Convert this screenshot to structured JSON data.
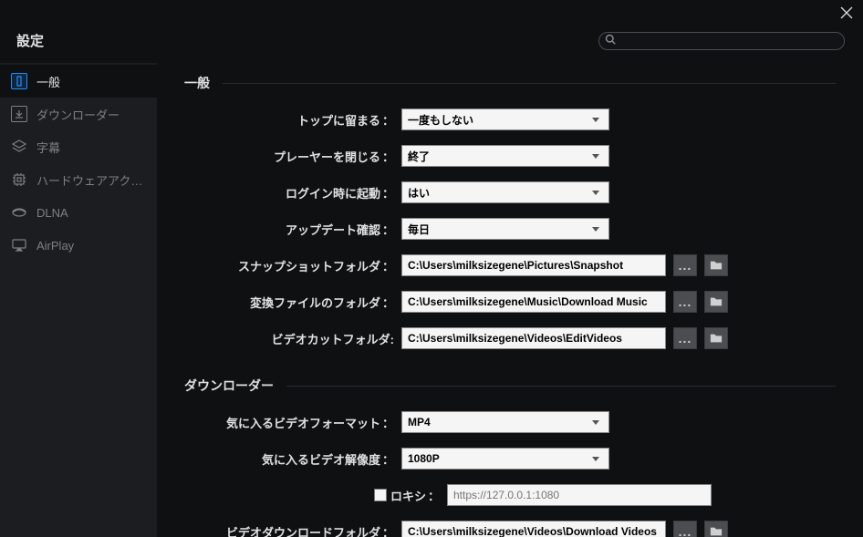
{
  "title": "設定",
  "search": {
    "placeholder": ""
  },
  "sidebar": {
    "items": [
      {
        "label": "一般"
      },
      {
        "label": "ダウンローダー"
      },
      {
        "label": "字幕"
      },
      {
        "label": "ハードウェアアク…"
      },
      {
        "label": "DLNA"
      },
      {
        "label": "AirPlay"
      }
    ]
  },
  "sections": {
    "general": {
      "heading": "一般",
      "stay_on_top": {
        "label": "トップに留まる",
        "value": "一度もしない"
      },
      "close_player": {
        "label": "プレーヤーを閉じる",
        "value": "終了"
      },
      "start_on_login": {
        "label": "ログイン時に起動",
        "value": "はい"
      },
      "update_check": {
        "label": "アップデート確認",
        "value": "毎日"
      },
      "snapshot_folder": {
        "label": "スナップショットフォルダ",
        "value": "C:\\Users\\milksizegene\\Pictures\\Snapshot"
      },
      "convert_folder": {
        "label": "変換ファイルのフォルダ",
        "value": "C:\\Users\\milksizegene\\Music\\Download Music"
      },
      "videocut_folder": {
        "label": "ビデオカットフォルダ",
        "value": "C:\\Users\\milksizegene\\Videos\\EditVideos"
      }
    },
    "downloader": {
      "heading": "ダウンローダー",
      "fav_format": {
        "label": "気に入るビデオフォーマット",
        "value": "MP4"
      },
      "fav_resolution": {
        "label": "気に入るビデオ解像度",
        "value": "1080P"
      },
      "proxy": {
        "label": "ロキシ",
        "placeholder": "https://127.0.0.1:1080"
      },
      "download_folder": {
        "label": "ビデオダウンロードフォルダ",
        "value": "C:\\Users\\milksizegene\\Videos\\Download Videos"
      }
    }
  },
  "colon": "："
}
